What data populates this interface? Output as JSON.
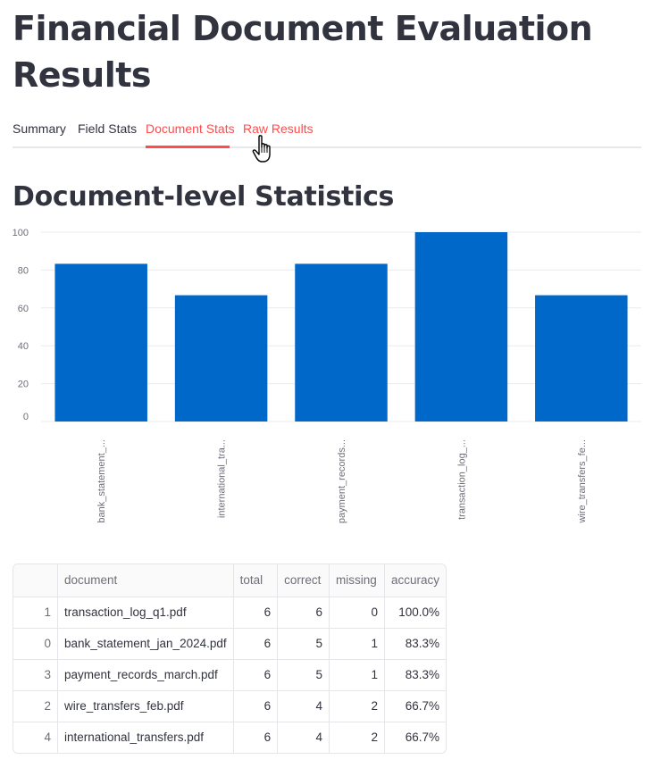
{
  "page": {
    "title": "Financial Document Evaluation Results"
  },
  "tabs": [
    {
      "label": "Summary",
      "active": false
    },
    {
      "label": "Field Stats",
      "active": false
    },
    {
      "label": "Document Stats",
      "active": true
    },
    {
      "label": "Raw Results",
      "active": false
    }
  ],
  "section": {
    "title": "Document-level Statistics"
  },
  "colors": {
    "accent": "#ff4b4b",
    "bar": "#0068c9"
  },
  "chart_data": {
    "type": "bar",
    "categories": [
      "bank_statement_...",
      "international_tra...",
      "payment_records...",
      "transaction_log_...",
      "wire_transfers_fe..."
    ],
    "values": [
      83.3,
      66.7,
      83.3,
      100.0,
      66.7
    ],
    "yticks": [
      "0",
      "20",
      "40",
      "60",
      "80",
      "100"
    ],
    "ylim": [
      0,
      100
    ],
    "grid": true
  },
  "table": {
    "columns": [
      "",
      "document",
      "total",
      "correct",
      "missing",
      "accuracy"
    ],
    "rows": [
      [
        "1",
        "transaction_log_q1.pdf",
        "6",
        "6",
        "0",
        "100.0%"
      ],
      [
        "0",
        "bank_statement_jan_2024.pdf",
        "6",
        "5",
        "1",
        "83.3%"
      ],
      [
        "3",
        "payment_records_march.pdf",
        "6",
        "5",
        "1",
        "83.3%"
      ],
      [
        "2",
        "wire_transfers_feb.pdf",
        "6",
        "4",
        "2",
        "66.7%"
      ],
      [
        "4",
        "international_transfers.pdf",
        "6",
        "4",
        "2",
        "66.7%"
      ]
    ]
  }
}
